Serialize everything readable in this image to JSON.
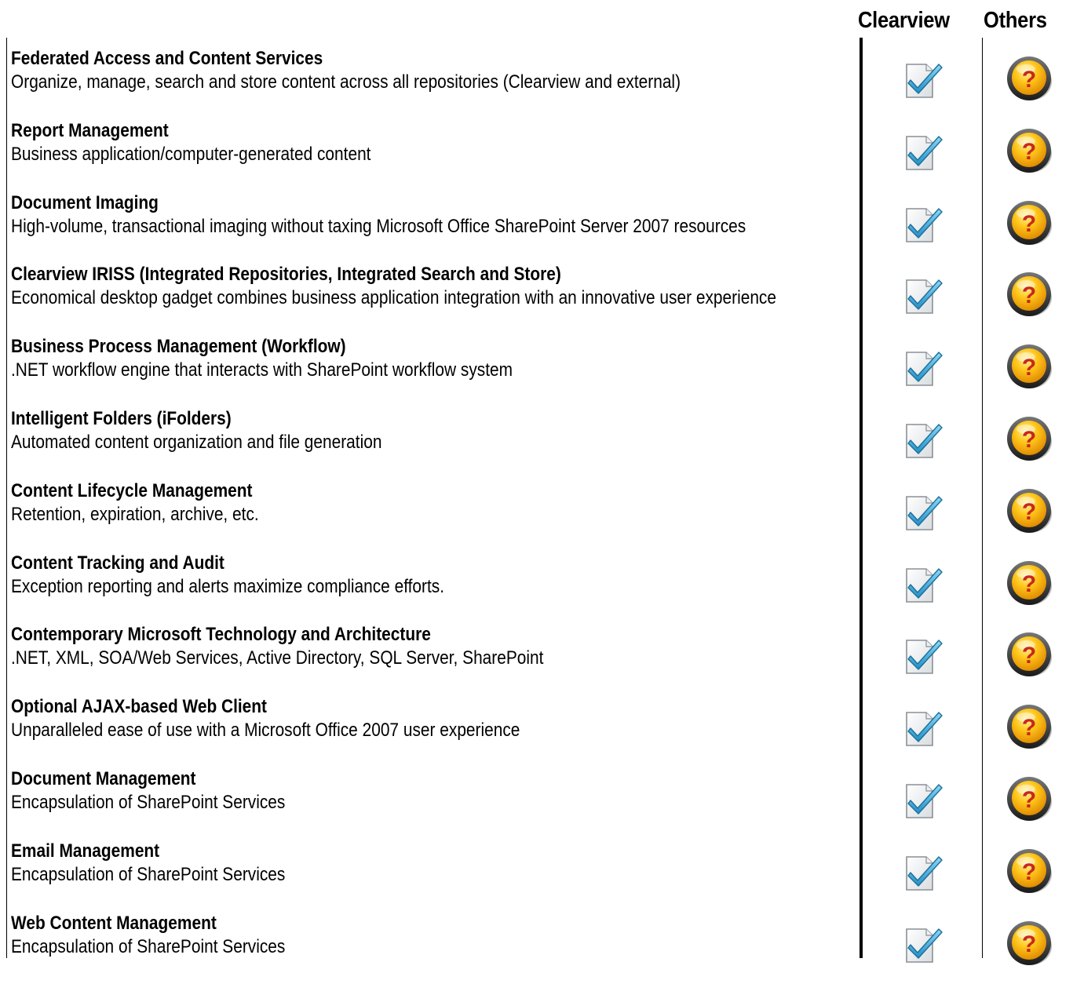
{
  "header": {
    "clearview_label": "Clearview",
    "others_label": "Others"
  },
  "icons": {
    "clearview_status": "checkbox-checked-icon",
    "others_status": "question-mark-icon"
  },
  "colors": {
    "check_blue": "#2a9fd6",
    "question_orange": "#f2a400",
    "question_mark_red": "#c8281e",
    "ring_dark": "#333333"
  },
  "features": [
    {
      "title": "Federated Access and Content Services",
      "description": "Organize, manage, search and store content across all repositories (Clearview and external)"
    },
    {
      "title": "Report Management",
      "description": "Business application/computer-generated content"
    },
    {
      "title": "Document Imaging",
      "description": "High-volume, transactional imaging without taxing Microsoft Office SharePoint Server 2007 resources"
    },
    {
      "title": "Clearview IRISS (Integrated Repositories, Integrated Search and Store)",
      "description": "Economical desktop gadget combines business application integration with an innovative user experience"
    },
    {
      "title": "Business Process Management (Workflow)",
      "description": ".NET workflow engine that interacts with SharePoint workflow system"
    },
    {
      "title": "Intelligent Folders (iFolders)",
      "description": "Automated content organization and file generation"
    },
    {
      "title": "Content Lifecycle Management",
      "description": "Retention, expiration, archive, etc."
    },
    {
      "title": "Content Tracking and Audit",
      "description": "Exception reporting and alerts maximize compliance efforts."
    },
    {
      "title": "Contemporary Microsoft Technology and Architecture",
      "description": ".NET, XML, SOA/Web Services, Active Directory, SQL Server, SharePoint"
    },
    {
      "title": "Optional AJAX-based Web Client",
      "description": "Unparalleled ease of use with a Microsoft Office 2007 user experience"
    },
    {
      "title": "Document Management",
      "description": "Encapsulation of SharePoint Services"
    },
    {
      "title": "Email Management",
      "description": "Encapsulation of SharePoint Services"
    },
    {
      "title": "Web Content Management",
      "description": "Encapsulation of SharePoint Services"
    }
  ]
}
